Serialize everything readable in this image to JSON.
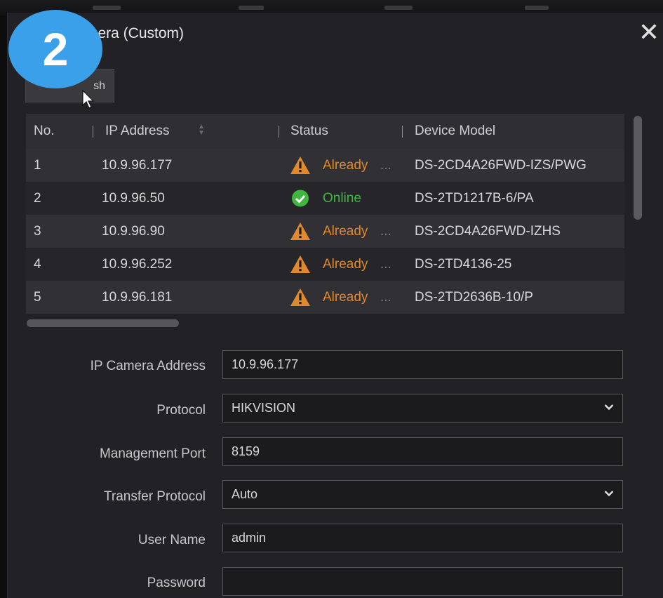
{
  "dialog": {
    "title": "mera (Custom)",
    "close_glyph": "✕",
    "step_badge": "2",
    "refresh_label": "sh"
  },
  "table": {
    "headers": {
      "no": "No.",
      "ip": "IP Address",
      "status": "Status",
      "model": "Device Model"
    },
    "rows": [
      {
        "no": "1",
        "ip": "10.9.96.177",
        "status": "Already",
        "status_type": "warning",
        "ellipsis": "...",
        "model": "DS-2CD4A26FWD-IZS/PWG"
      },
      {
        "no": "2",
        "ip": "10.9.96.50",
        "status": "Online",
        "status_type": "online",
        "ellipsis": "",
        "model": "DS-2TD1217B-6/PA"
      },
      {
        "no": "3",
        "ip": "10.9.96.90",
        "status": "Already",
        "status_type": "warning",
        "ellipsis": "...",
        "model": "DS-2CD4A26FWD-IZHS"
      },
      {
        "no": "4",
        "ip": "10.9.96.252",
        "status": "Already",
        "status_type": "warning",
        "ellipsis": "...",
        "model": "DS-2TD4136-25"
      },
      {
        "no": "5",
        "ip": "10.9.96.181",
        "status": "Already",
        "status_type": "warning",
        "ellipsis": "...",
        "model": "DS-2TD2636B-10/P"
      }
    ]
  },
  "form": {
    "ip_camera_address": {
      "label": "IP Camera Address",
      "value": "10.9.96.177"
    },
    "protocol": {
      "label": "Protocol",
      "value": "HIKVISION"
    },
    "management_port": {
      "label": "Management Port",
      "value": "8159"
    },
    "transfer_protocol": {
      "label": "Transfer Protocol",
      "value": "Auto"
    },
    "user_name": {
      "label": "User Name",
      "value": "admin"
    },
    "password": {
      "label": "Password",
      "value": ""
    }
  },
  "colors": {
    "warning": "#e0892d",
    "online": "#3fb63f",
    "badge": "#3aa0ea"
  },
  "icons": {
    "warning": "warning-triangle-icon",
    "online": "check-circle-icon",
    "close": "close-icon",
    "dropdown": "chevron-down-icon",
    "sort": "sort-icon",
    "cursor": "mouse-cursor-icon"
  }
}
